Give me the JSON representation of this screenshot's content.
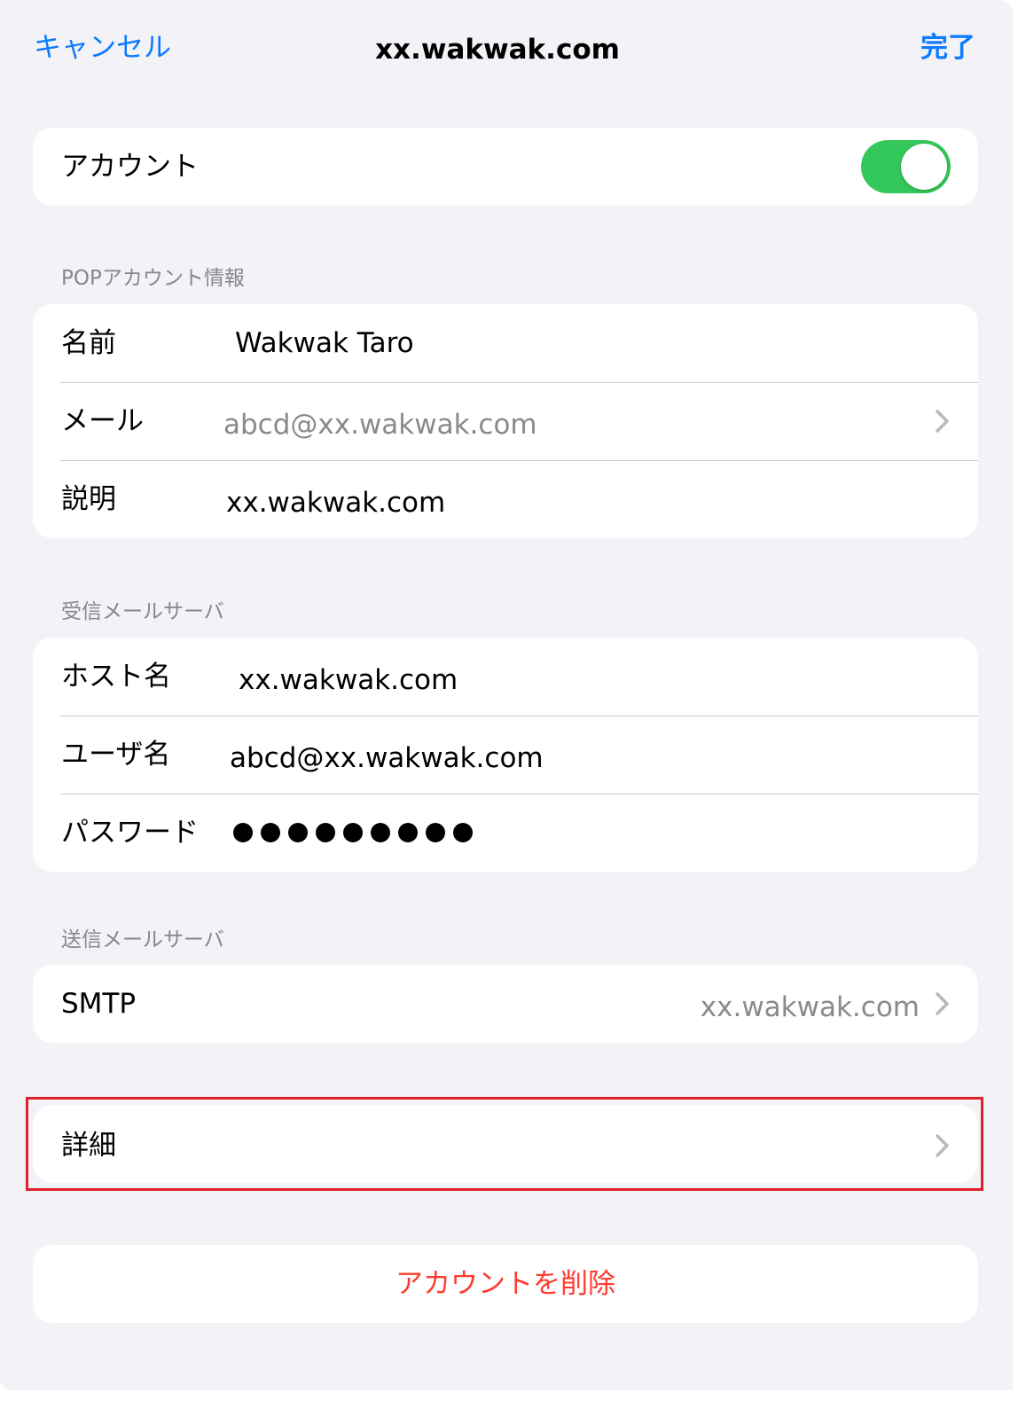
{
  "nav": {
    "cancel_label": "キャンセル",
    "title": "xx.wakwak.com",
    "done_label": "完了"
  },
  "account": {
    "label": "アカウント",
    "toggle_state": "on"
  },
  "pop_section": {
    "header": "POPアカウント情報",
    "name_label": "名前",
    "name_value": "Wakwak Taro",
    "email_label": "メール",
    "email_value": "abcd@xx.wakwak.com",
    "description_label": "説明",
    "description_value": "xx.wakwak.com"
  },
  "incoming_section": {
    "header": "受信メールサーバ",
    "host_label": "ホスト名",
    "host_value": "xx.wakwak.com",
    "username_label": "ユーザ名",
    "username_value": "abcd@xx.wakwak.com",
    "password_label": "パスワード",
    "password_dot_count": 9
  },
  "outgoing_section": {
    "header": "送信メールサーバ",
    "smtp_label": "SMTP",
    "smtp_value": "xx.wakwak.com"
  },
  "advanced": {
    "label": "詳細"
  },
  "delete_account": {
    "label": "アカウントを削除"
  },
  "colors": {
    "accent": "#0a7aff",
    "toggle_on": "#34c759",
    "destructive": "#ff3b30",
    "highlight": "#e0202c"
  }
}
